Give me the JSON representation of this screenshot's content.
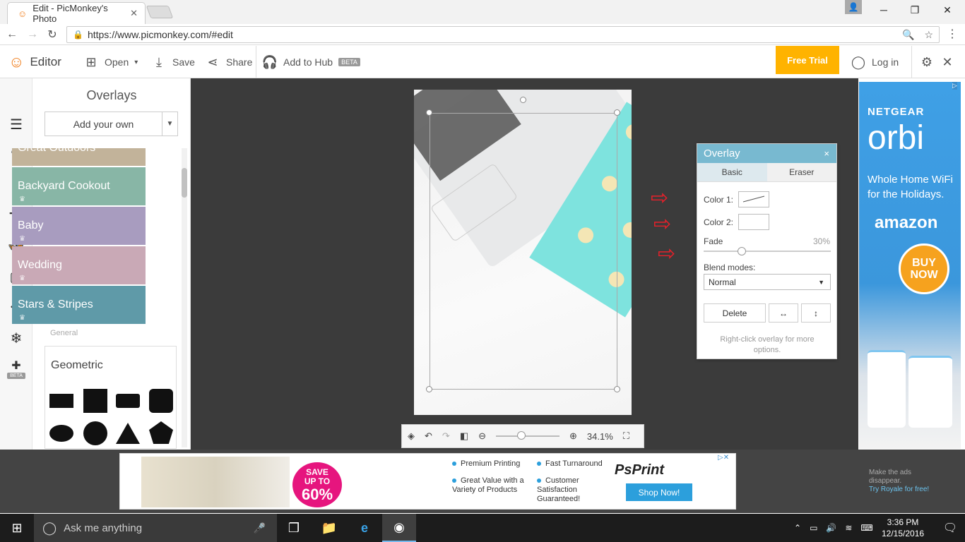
{
  "browser": {
    "tab_title": "Edit - PicMonkey's Photo",
    "url": "https://www.picmonkey.com/#edit",
    "minimize": "─",
    "maximize": "❐",
    "close": "✕"
  },
  "toolbar": {
    "editor_label": "Editor",
    "open_label": "Open",
    "save_label": "Save",
    "share_label": "Share",
    "hub_label": "Add to Hub",
    "beta": "BETA",
    "free_trial": "Free Trial",
    "login_label": "Log in"
  },
  "panel": {
    "title": "Overlays",
    "add_own": "Add your own",
    "categories": [
      {
        "label": "Great Outdoors",
        "color": "#c2b39a"
      },
      {
        "label": "Backyard Cookout",
        "color": "#88b6a6"
      },
      {
        "label": "Baby",
        "color": "#a89cbf"
      },
      {
        "label": "Wedding",
        "color": "#c9a9b6"
      },
      {
        "label": "Stars & Stripes",
        "color": "#5f9aa8"
      }
    ],
    "general_label": "General",
    "geometric_title": "Geometric",
    "rail_beta": "BETA"
  },
  "canvas": {
    "zoom": "34.1%"
  },
  "overlay_dialog": {
    "title": "Overlay",
    "close": "×",
    "tabs": [
      "Basic",
      "Eraser"
    ],
    "color1_label": "Color 1:",
    "color2_label": "Color 2:",
    "fade_label": "Fade",
    "fade_value": "30%",
    "fade_fraction": 0.3,
    "blend_label": "Blend modes:",
    "blend_value": "Normal",
    "delete_label": "Delete",
    "hint": "Right-click overlay for more options."
  },
  "right_ad": {
    "brand": "NETGEAR",
    "product": "orbi",
    "subtitle": "Whole Home WiFi for the Holidays.",
    "retailer": "amazon",
    "cta": "BUY NOW"
  },
  "bottom_ad": {
    "save_top": "SAVE",
    "save_upto": "UP TO",
    "save_pct": "60%",
    "features": [
      "Premium Printing",
      "Fast Turnaround",
      "Great Value with a Variety of Products",
      "Customer Satisfaction Guaranteed!"
    ],
    "brand": "PsPrint",
    "cta": "Shop Now!",
    "royale_line1": "Make the ads",
    "royale_line2": "disappear.",
    "royale_link": "Try Royale for free!"
  },
  "taskbar": {
    "search_placeholder": "Ask me anything",
    "time": "3:36 PM",
    "date": "12/15/2016"
  }
}
